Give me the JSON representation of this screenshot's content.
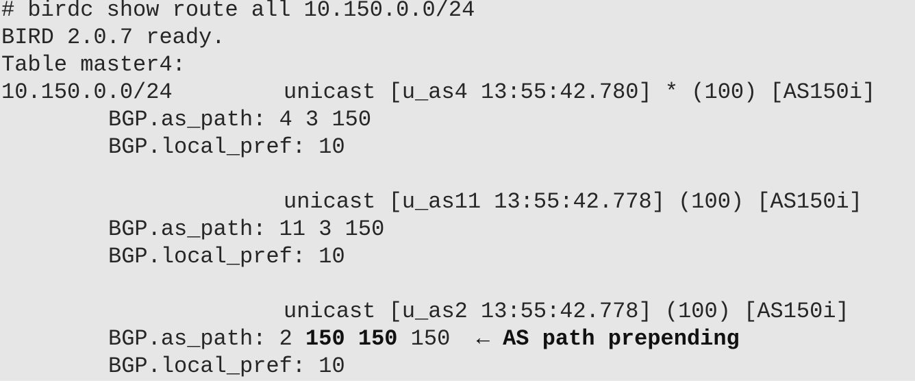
{
  "terminal": {
    "command": "# birdc show route all 10.150.0.0/24",
    "ready": "BIRD 2.0.7 ready.",
    "table": "Table master4:",
    "route1": {
      "prefix": "10.150.0.0/24",
      "info": "unicast [u_as4 13:55:42.780] * (100) [AS150i]",
      "as_path": "BGP.as_path: 4 3 150",
      "local_pref": "BGP.local_pref: 10"
    },
    "route2": {
      "info": "unicast [u_as11 13:55:42.778] (100) [AS150i]",
      "as_path": "BGP.as_path: 11 3 150",
      "local_pref": "BGP.local_pref: 10"
    },
    "route3": {
      "info": "unicast [u_as2 13:55:42.778] (100) [AS150i]",
      "as_path_prefix": "BGP.as_path: 2 ",
      "as_path_bold": "150 150",
      "as_path_suffix": " 150  ",
      "arrow": "←",
      "annotation": " AS path prepending",
      "local_pref": "BGP.local_pref: 10"
    }
  }
}
